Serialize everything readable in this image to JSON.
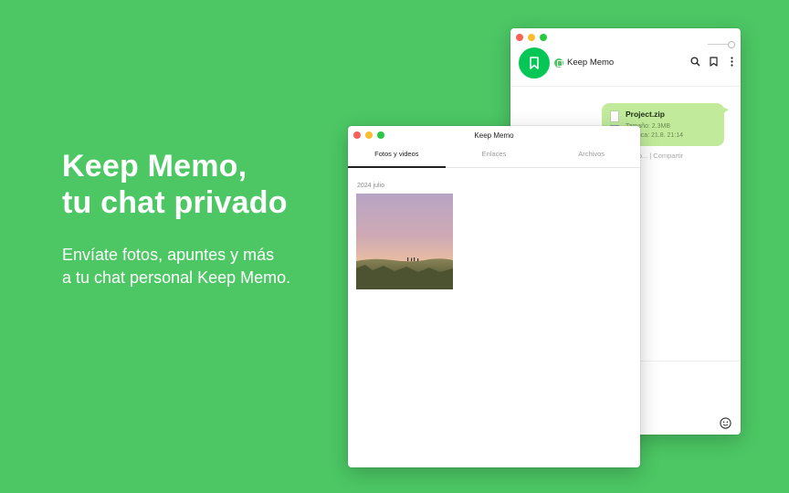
{
  "hero": {
    "title_line1": "Keep Memo,",
    "title_line2": "tu chat privado",
    "subtitle_line1": "Envíate fotos, apuntes y más",
    "subtitle_line2": "a tu chat personal Keep Memo."
  },
  "chat_window": {
    "chat_name": "Keep Memo",
    "message": {
      "file_name": "Project.zip",
      "size_line": "Tamaño: 2.3MB",
      "expiry_line": "Caduca: 21.8. 21:14"
    },
    "actions": "Guardar como... | Compartir"
  },
  "media_window": {
    "title": "Keep Memo",
    "tabs": [
      "Fotos y videos",
      "Enlaces",
      "Archivos"
    ],
    "active_tab": "Fotos y videos",
    "section_date": "2024 julio"
  },
  "colors": {
    "background": "#4cc764",
    "accent": "#06c755",
    "bubble": "#c1eb9b"
  }
}
